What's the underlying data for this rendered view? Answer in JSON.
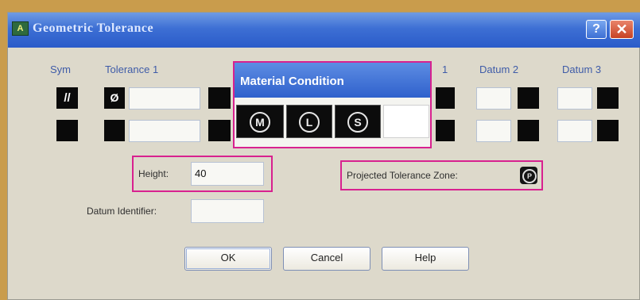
{
  "window": {
    "title": "Geometric Tolerance",
    "app_icon_text": "A",
    "help_glyph": "?",
    "close_glyph": "✕"
  },
  "columns": {
    "sym": "Sym",
    "tolerance1": "Tolerance 1",
    "datum1_partial": "1",
    "datum2": "Datum 2",
    "datum3": "Datum 3"
  },
  "row1": {
    "sym_glyph": "//",
    "dia_glyph": "Ø",
    "tolerance_value": ""
  },
  "row2": {
    "tolerance_value": ""
  },
  "material_condition": {
    "title": "Material Condition",
    "options": [
      "M",
      "L",
      "S"
    ]
  },
  "height": {
    "label": "Height:",
    "value": "40"
  },
  "projected_tolerance_zone": {
    "label": "Projected Tolerance Zone:",
    "glyph": "P"
  },
  "datum_identifier": {
    "label": "Datum Identifier:",
    "value": ""
  },
  "buttons": {
    "ok": "OK",
    "cancel": "Cancel",
    "help": "Help"
  }
}
